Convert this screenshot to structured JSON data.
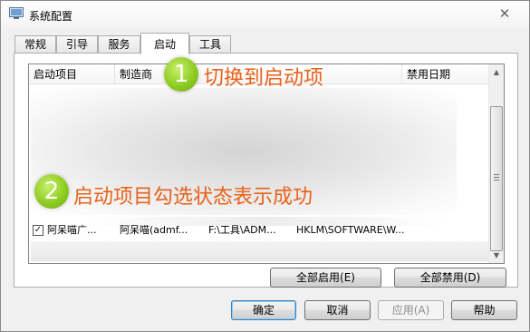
{
  "window": {
    "title": "系统配置",
    "close_glyph": "✕"
  },
  "tabs": [
    {
      "label": "常规",
      "active": false
    },
    {
      "label": "引导",
      "active": false
    },
    {
      "label": "服务",
      "active": false
    },
    {
      "label": "启动",
      "active": true
    },
    {
      "label": "工具",
      "active": false
    }
  ],
  "listview": {
    "columns": [
      "启动项目",
      "制造商",
      "",
      "禁用日期"
    ],
    "rows": [
      {
        "checked": true,
        "item": "阿呆喵广...",
        "manufacturer": "阿呆喵(admf...",
        "command": "F:\\工具\\ADM...",
        "location": "HKLM\\SOFTWARE\\W..."
      }
    ]
  },
  "annotations": [
    {
      "badge": "1",
      "text": "切换到启动项"
    },
    {
      "badge": "2",
      "text": "启动项目勾选状态表示成功"
    }
  ],
  "buttons": {
    "enable_all": "全部启用(E)",
    "disable_all": "全部禁用(D)",
    "ok": "确定",
    "cancel": "取消",
    "apply": "应用(A)",
    "help": "帮助"
  },
  "colors": {
    "annotation_text": "#e8611a",
    "badge_green": "#8fcd23",
    "default_button_border": "#3c7fb1"
  }
}
